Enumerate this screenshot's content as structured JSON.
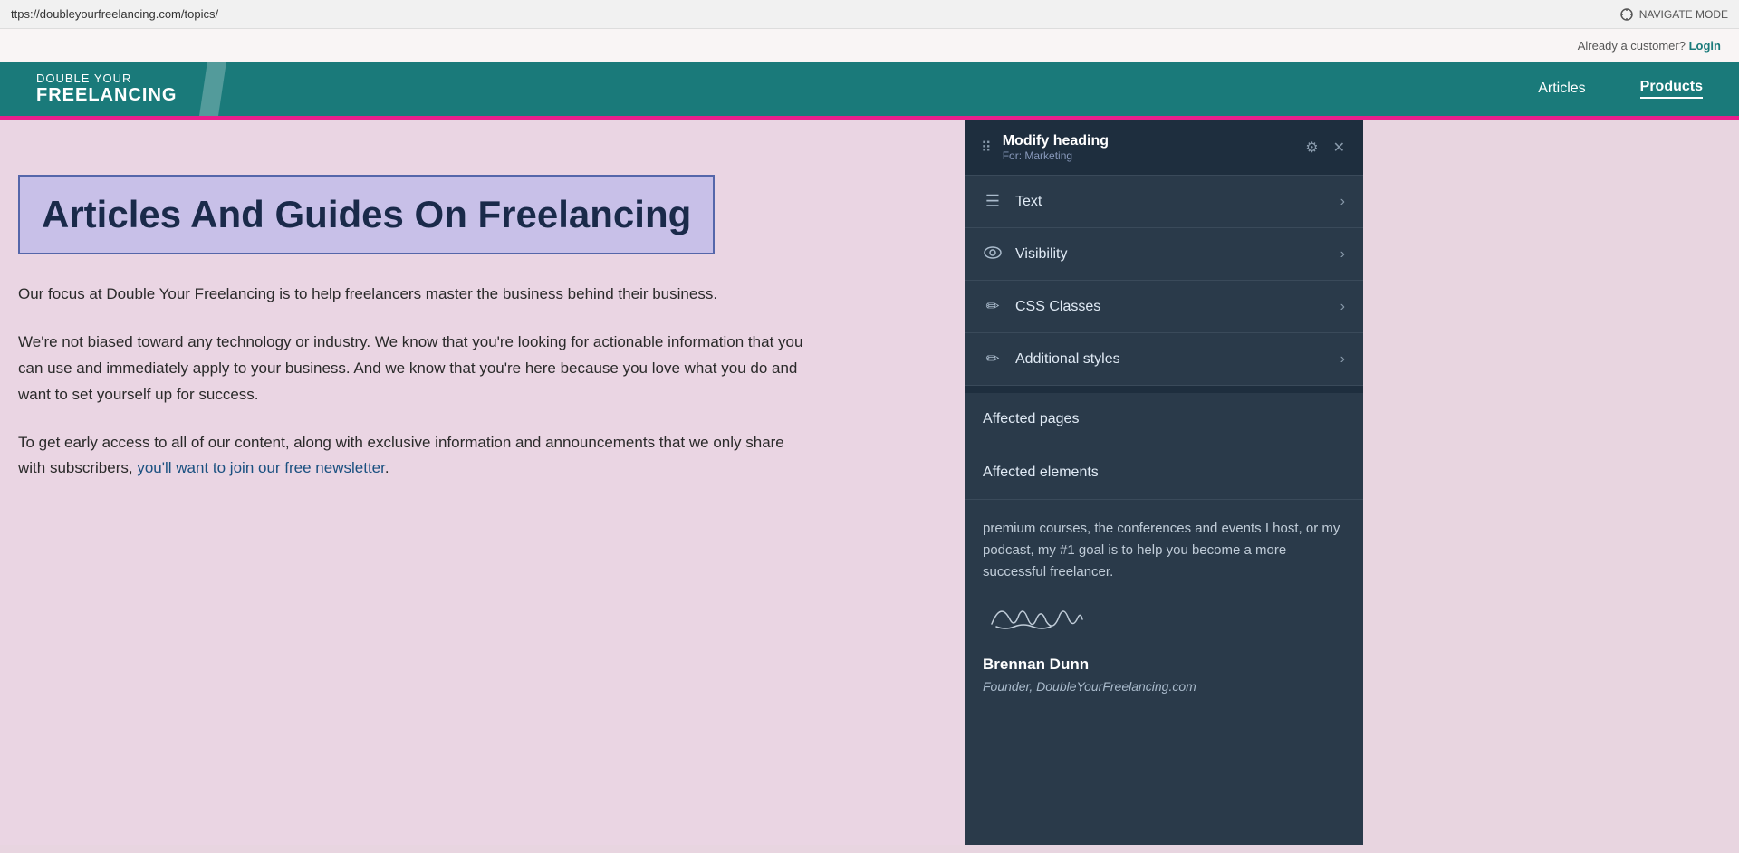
{
  "browser": {
    "url": "ttps://doubleyourfreelancing.com/topics/",
    "navigate_mode_label": "NAVIGATE MODE"
  },
  "site": {
    "logo_top": "DOUBLE YOUR",
    "logo_bottom": "FREELANCING",
    "nav_items": [
      {
        "label": "Articles",
        "active": false
      },
      {
        "label": "Products",
        "active": true
      }
    ],
    "customer_bar_text": "Already a customer?",
    "login_label": "Login"
  },
  "content": {
    "heading": "Articles And Guides On Freelancing",
    "para1": "Our focus at Double Your Freelancing is to help freelancers master the business behind their business.",
    "para2": "We're not biased toward any technology or industry. We know that you're looking for actionable information that you can use and immediately apply to your business. And we know that you're here because you love what you do and want to set yourself up for success.",
    "para3_before_link": "To get early access to all of our content, along with exclusive information and announcements that we only share with subscribers,",
    "link_text": "you'll want to join our free newsletter",
    "para3_after_link": "."
  },
  "panel": {
    "title": "Modify heading",
    "subtitle": "For: Marketing",
    "drag_icon": "⠿",
    "settings_icon": "⚙",
    "close_icon": "✕",
    "menu_items": [
      {
        "id": "text",
        "icon": "☰",
        "label": "Text"
      },
      {
        "id": "visibility",
        "icon": "👁",
        "label": "Visibility"
      },
      {
        "id": "css_classes",
        "icon": "✏",
        "label": "CSS Classes"
      },
      {
        "id": "additional_styles",
        "icon": "✏",
        "label": "Additional styles"
      }
    ],
    "section_items": [
      {
        "id": "affected_pages",
        "label": "Affected pages"
      },
      {
        "id": "affected_elements",
        "label": "Affected elements"
      }
    ],
    "lower_text": "premium courses, the conferences and events I host, or my podcast, my #1 goal is to help you become a more successful freelancer.",
    "author_name": "Brennan Dunn",
    "author_title": "Founder, DoubleYourFreelancing.com"
  }
}
